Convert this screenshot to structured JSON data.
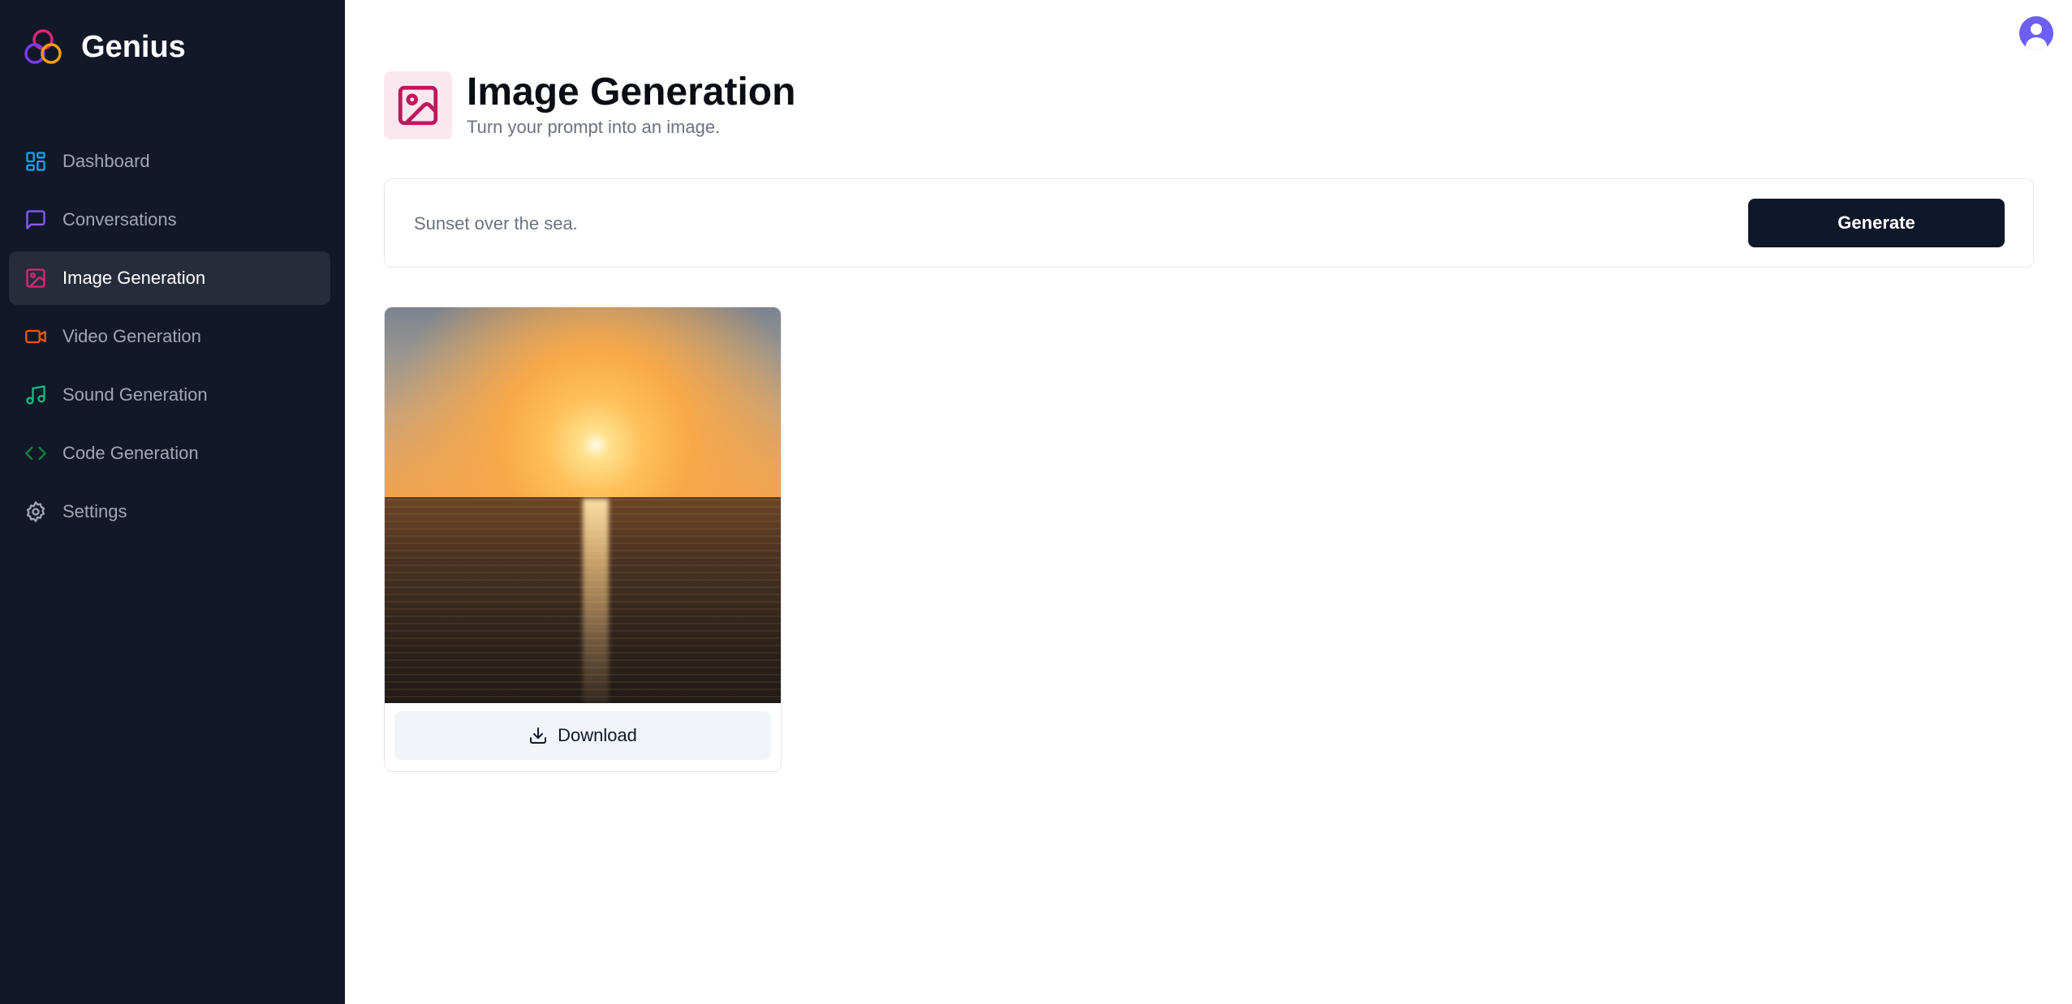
{
  "app": {
    "name": "Genius"
  },
  "sidebar": {
    "items": [
      {
        "label": "Dashboard",
        "icon": "layout-dashboard-icon",
        "color": "#0ea5e9",
        "active": false
      },
      {
        "label": "Conversations",
        "icon": "message-square-icon",
        "color": "#8b5cf6",
        "active": false
      },
      {
        "label": "Image Generation",
        "icon": "image-icon",
        "color": "#db2777",
        "active": true
      },
      {
        "label": "Video Generation",
        "icon": "video-icon",
        "color": "#ea580c",
        "active": false
      },
      {
        "label": "Sound Generation",
        "icon": "music-icon",
        "color": "#10b981",
        "active": false
      },
      {
        "label": "Code Generation",
        "icon": "code-icon",
        "color": "#15803d",
        "active": false
      },
      {
        "label": "Settings",
        "icon": "settings-icon",
        "color": "#a1a7b3",
        "active": false
      }
    ]
  },
  "header": {
    "title": "Image Generation",
    "subtitle": "Turn your prompt into an image.",
    "icon": "image-icon",
    "icon_color": "#be185d",
    "icon_bg": "#fce7ef"
  },
  "prompt": {
    "value": "Sunset over the sea.",
    "generate_label": "Generate"
  },
  "results": {
    "images": [
      {
        "alt": "sunset-over-sea-image",
        "download_label": "Download"
      }
    ]
  },
  "user": {
    "avatar": "user-avatar-icon",
    "color": "#6d5ef5"
  }
}
